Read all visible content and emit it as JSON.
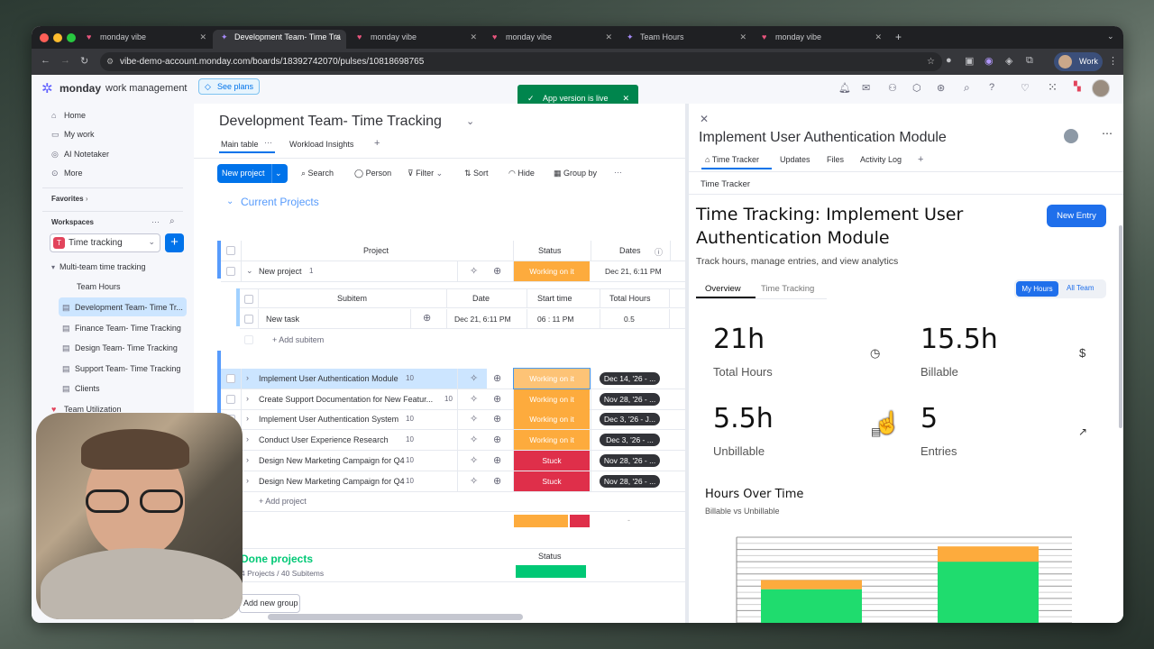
{
  "browser": {
    "tabs": [
      {
        "label": "monday vibe"
      },
      {
        "label": "Development Team- Time Tra"
      },
      {
        "label": "monday vibe"
      },
      {
        "label": "monday vibe"
      },
      {
        "label": "Team Hours"
      },
      {
        "label": "monday vibe"
      }
    ],
    "url": "vibe-demo-account.monday.com/boards/18392742070/pulses/10818698765",
    "profile_label": "Work"
  },
  "app": {
    "brand": "monday",
    "brand_sub": "work management",
    "see_plans": "See plans",
    "toast": "App version is live"
  },
  "sidebar": {
    "nav": [
      {
        "label": "Home",
        "icon": "home-icon"
      },
      {
        "label": "My work",
        "icon": "briefcase-icon"
      },
      {
        "label": "AI Notetaker",
        "icon": "record-icon"
      },
      {
        "label": "More",
        "icon": "more-icon"
      }
    ],
    "favorites": "Favorites",
    "workspaces": "Workspaces",
    "workspace_badge": "T",
    "workspace_name": "Time tracking",
    "folder": "Multi-team time tracking",
    "boards": [
      {
        "label": "Team Hours"
      },
      {
        "label": "Development Team- Time Tr..."
      },
      {
        "label": "Finance Team- Time Tracking"
      },
      {
        "label": "Design Team- Time Tracking"
      },
      {
        "label": "Support Team- Time Tracking"
      },
      {
        "label": "Clients"
      }
    ],
    "team_util": "Team Utilization"
  },
  "board": {
    "title": "Development Team- Time Tracking",
    "views": [
      "Main table",
      "Workload Insights"
    ],
    "toolbar": {
      "new_project": "New project",
      "search": "Search",
      "person": "Person",
      "filter": "Filter",
      "sort": "Sort",
      "hide": "Hide",
      "group_by": "Group by"
    },
    "group_name": "Current Projects",
    "columns": {
      "project": "Project",
      "status": "Status",
      "dates": "Dates"
    },
    "first_item": {
      "name": "New project",
      "count": "1",
      "status": "Working on it",
      "date": "Dec 21, 6:11 PM"
    },
    "subitem_columns": {
      "subitem": "Subitem",
      "date": "Date",
      "start": "Start time",
      "hours": "Total Hours"
    },
    "subitem": {
      "name": "New task",
      "date": "Dec 21, 6:11 PM",
      "start": "06 : 11  PM",
      "hours": "0.5"
    },
    "add_subitem": "+ Add subitem",
    "items": [
      {
        "name": "Implement User Authentication Module",
        "count": "10",
        "status": "Working on it",
        "date": "Dec 14, '26 - ...",
        "color": "#fdab3d"
      },
      {
        "name": "Create Support Documentation for New Featur...",
        "count": "10",
        "status": "Working on it",
        "date": "Nov 28, '26 - ...",
        "color": "#fdab3d"
      },
      {
        "name": "Implement User Authentication System",
        "count": "10",
        "status": "Working on it",
        "date": "Dec 3, '26 - J...",
        "color": "#fdab3d"
      },
      {
        "name": "Conduct User Experience Research",
        "count": "10",
        "status": "Working on it",
        "date": "Dec 3, '26 - ...",
        "color": "#fdab3d"
      },
      {
        "name": "Design New Marketing Campaign for Q4",
        "count": "10",
        "status": "Stuck",
        "date": "Nov 28, '26 - ...",
        "color": "#df2f4a"
      },
      {
        "name": "Design New Marketing Campaign for Q4",
        "count": "10",
        "status": "Stuck",
        "date": "Nov 28, '26 - ...",
        "color": "#df2f4a"
      }
    ],
    "add_project": "+ Add project",
    "summary_dash": "-",
    "done_group": "Done projects",
    "done_meta": "4 Projects / 40 Subitems",
    "done_status_header": "Status",
    "add_group": "Add new group",
    "status_summary": {
      "working": 0.72,
      "stuck": 0.28
    }
  },
  "panel": {
    "item_title": "Implement User Authentication Module",
    "tabs": [
      "Time Tracker",
      "Updates",
      "Files",
      "Activity Log"
    ],
    "section_label": "Time Tracker",
    "heading": "Time Tracking: Implement User Authentication Module",
    "subtitle": "Track hours, manage entries, and view analytics",
    "new_entry": "New Entry",
    "subtabs": [
      "Overview",
      "Time Tracking"
    ],
    "toggle": [
      "My Hours",
      "All Team"
    ],
    "stats": [
      {
        "value": "21h",
        "label": "Total Hours",
        "icon": "clock-icon"
      },
      {
        "value": "15.5h",
        "label": "Billable",
        "icon": "dollar-icon"
      },
      {
        "value": "5.5h",
        "label": "Unbillable",
        "icon": "document-icon"
      },
      {
        "value": "5",
        "label": "Entries",
        "icon": "trend-icon"
      }
    ],
    "chart_title": "Hours Over Time",
    "chart_subtitle": "Billable vs Unbillable"
  },
  "chart_data": {
    "type": "bar",
    "title": "Hours Over Time",
    "subtitle": "Billable vs Unbillable",
    "series": [
      {
        "name": "Billable",
        "values": [
          5.5,
          10
        ],
        "color": "#1fdc6e"
      },
      {
        "name": "Unbillable",
        "values": [
          1.5,
          2.5
        ],
        "color": "#fdab3d"
      }
    ],
    "ylim": [
      0,
      14
    ],
    "grid": true
  }
}
